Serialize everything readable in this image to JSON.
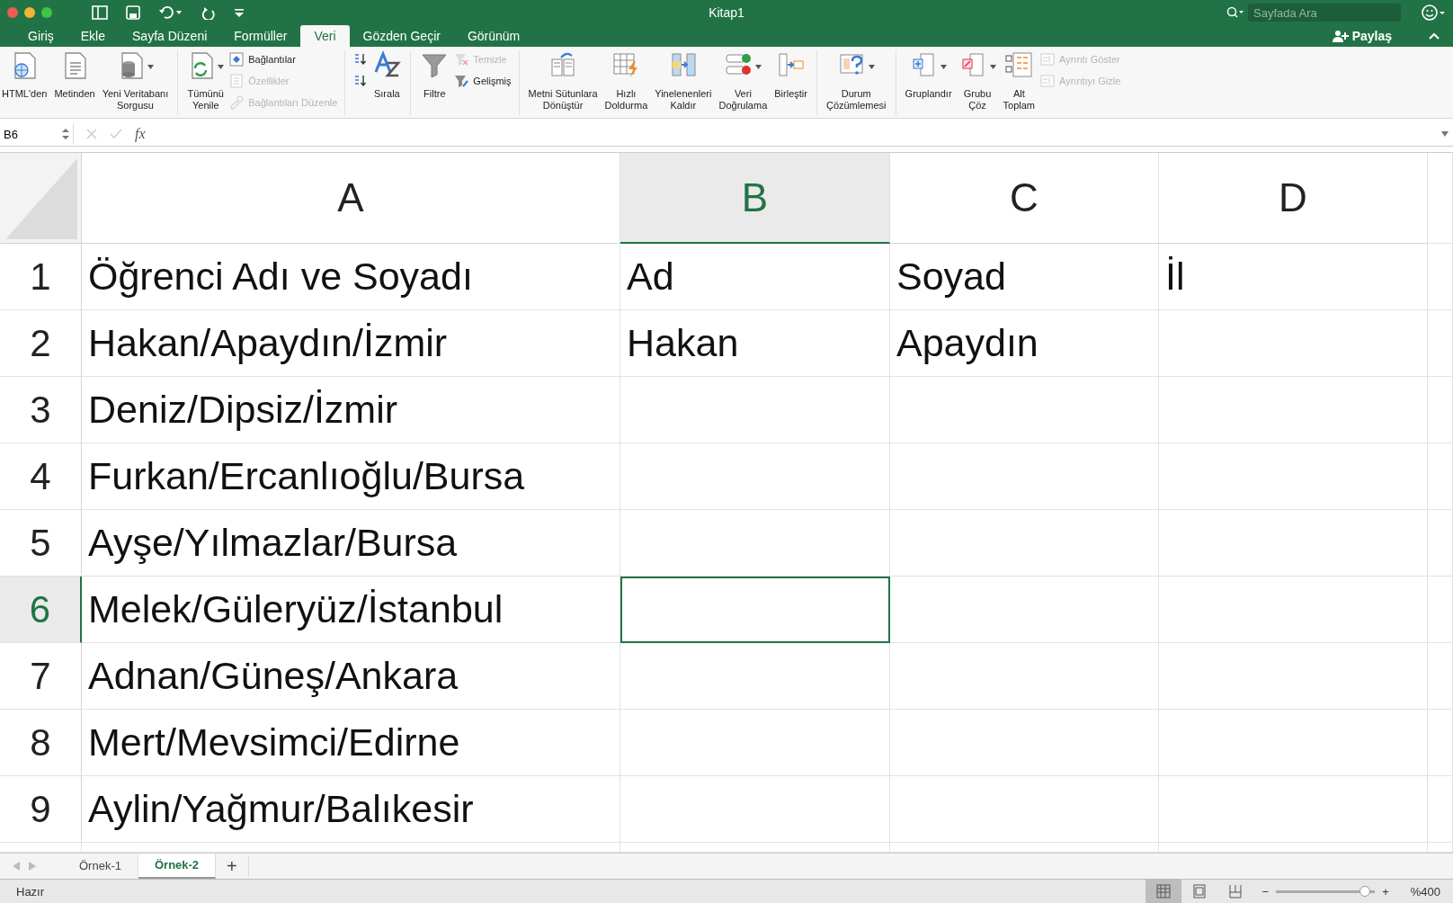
{
  "window": {
    "title": "Kitap1",
    "search": {
      "placeholder": "Sayfada Ara"
    }
  },
  "tabs": [
    {
      "label": "Giriş",
      "selected": false
    },
    {
      "label": "Ekle",
      "selected": false
    },
    {
      "label": "Sayfa Düzeni",
      "selected": false
    },
    {
      "label": "Formüller",
      "selected": false
    },
    {
      "label": "Veri",
      "selected": true
    },
    {
      "label": "Gözden Geçir",
      "selected": false
    },
    {
      "label": "Görünüm",
      "selected": false
    }
  ],
  "share": {
    "label": "Paylaş"
  },
  "ribbon": [
    {
      "items": [
        {
          "kind": "large",
          "lines": [
            "HTML'den"
          ],
          "disabled": false,
          "dropdown": false
        },
        {
          "kind": "large",
          "lines": [
            "Metinden"
          ],
          "disabled": false,
          "dropdown": false
        },
        {
          "kind": "large",
          "lines": [
            "Yeni Veritabanı",
            "Sorgusu"
          ],
          "disabled": false,
          "dropdown": true
        }
      ]
    },
    {
      "items": [
        {
          "kind": "large",
          "lines": [
            "Tümünü",
            "Yenile"
          ],
          "disabled": false,
          "dropdown": true
        },
        {
          "kind": "small",
          "lines": [
            "Bağlantılar"
          ],
          "disabled": false
        },
        {
          "kind": "small",
          "lines": [
            "Özellikler"
          ],
          "disabled": true
        },
        {
          "kind": "small",
          "lines": [
            "Bağlantıları Düzenle"
          ],
          "disabled": true
        }
      ]
    },
    {
      "items": [
        {
          "kind": "icon"
        },
        {
          "kind": "icon"
        },
        {
          "kind": "large",
          "lines": [
            "Sırala"
          ],
          "disabled": false,
          "dropdown": false
        }
      ]
    },
    {
      "items": [
        {
          "kind": "large",
          "lines": [
            "Filtre"
          ],
          "disabled": false,
          "dropdown": false
        },
        {
          "kind": "small",
          "lines": [
            "Temizle"
          ],
          "disabled": true
        },
        {
          "kind": "small",
          "lines": [
            "Gelişmiş"
          ],
          "disabled": false
        }
      ]
    },
    {
      "items": [
        {
          "kind": "large",
          "lines": [
            "Metni Sütunlara",
            "Dönüştür"
          ],
          "disabled": false,
          "dropdown": false
        },
        {
          "kind": "large",
          "lines": [
            "Hızlı",
            "Doldurma"
          ],
          "disabled": false,
          "dropdown": false
        },
        {
          "kind": "large",
          "lines": [
            "Yinelenenleri",
            "Kaldır"
          ],
          "disabled": false,
          "dropdown": false
        },
        {
          "kind": "large",
          "lines": [
            "Veri",
            "Doğrulama"
          ],
          "disabled": false,
          "dropdown": true
        },
        {
          "kind": "large",
          "lines": [
            "Birleştir"
          ],
          "disabled": false,
          "dropdown": false
        }
      ]
    },
    {
      "items": [
        {
          "kind": "large",
          "lines": [
            "Durum",
            "Çözümlemesi"
          ],
          "disabled": false,
          "dropdown": true
        }
      ]
    },
    {
      "items": [
        {
          "kind": "large",
          "lines": [
            "Gruplandır"
          ],
          "disabled": false,
          "dropdown": true
        },
        {
          "kind": "large",
          "lines": [
            "Grubu",
            "Çöz"
          ],
          "disabled": false,
          "dropdown": true
        },
        {
          "kind": "large",
          "lines": [
            "Alt",
            "Toplam"
          ],
          "disabled": false,
          "dropdown": false
        },
        {
          "kind": "small",
          "lines": [
            "Ayrıntı Göster"
          ],
          "disabled": true
        },
        {
          "kind": "small",
          "lines": [
            "Ayrıntıyı Gizle"
          ],
          "disabled": true
        }
      ]
    }
  ],
  "formula_bar": {
    "name_box": "B6",
    "fx": "fx"
  },
  "columns": [
    {
      "label": "A",
      "selected": false
    },
    {
      "label": "B",
      "selected": true
    },
    {
      "label": "C",
      "selected": false
    },
    {
      "label": "D",
      "selected": false
    }
  ],
  "rows": [
    {
      "number": "1",
      "selected": false,
      "cells": [
        {
          "text": "Öğrenci Adı ve Soyadı",
          "selected": false
        },
        {
          "text": "Ad",
          "selected": false
        },
        {
          "text": "Soyad",
          "selected": false
        },
        {
          "text": "İl",
          "selected": false
        }
      ]
    },
    {
      "number": "2",
      "selected": false,
      "cells": [
        {
          "text": "Hakan/Apaydın/İzmir",
          "selected": false
        },
        {
          "text": "Hakan",
          "selected": false
        },
        {
          "text": "Apaydın",
          "selected": false
        },
        {
          "selected": false
        }
      ]
    },
    {
      "number": "3",
      "selected": false,
      "cells": [
        {
          "text": "Deniz/Dipsiz/İzmir",
          "selected": false
        },
        {
          "selected": false
        },
        {
          "selected": false
        },
        {
          "selected": false
        }
      ]
    },
    {
      "number": "4",
      "selected": false,
      "cells": [
        {
          "text": "Furkan/Ercanlıoğlu/Bursa",
          "selected": false
        },
        {
          "selected": false
        },
        {
          "selected": false
        },
        {
          "selected": false
        }
      ]
    },
    {
      "number": "5",
      "selected": false,
      "cells": [
        {
          "text": "Ayşe/Yılmazlar/Bursa",
          "selected": false
        },
        {
          "selected": false
        },
        {
          "selected": false
        },
        {
          "selected": false
        }
      ]
    },
    {
      "number": "6",
      "selected": true,
      "cells": [
        {
          "text": "Melek/Güleryüz/İstanbul",
          "selected": false
        },
        {
          "selected": true
        },
        {
          "selected": false
        },
        {
          "selected": false
        }
      ]
    },
    {
      "number": "7",
      "selected": false,
      "cells": [
        {
          "text": "Adnan/Güneş/Ankara",
          "selected": false
        },
        {
          "selected": false
        },
        {
          "selected": false
        },
        {
          "selected": false
        }
      ]
    },
    {
      "number": "8",
      "selected": false,
      "cells": [
        {
          "text": "Mert/Mevsimci/Edirne",
          "selected": false
        },
        {
          "selected": false
        },
        {
          "selected": false
        },
        {
          "selected": false
        }
      ]
    },
    {
      "number": "9",
      "selected": false,
      "cells": [
        {
          "text": "Aylin/Yağmur/Balıkesir",
          "selected": false
        },
        {
          "selected": false
        },
        {
          "selected": false
        },
        {
          "selected": false
        }
      ]
    }
  ],
  "sheets": [
    {
      "label": "Örnek-1",
      "selected": false
    },
    {
      "label": "Örnek-2",
      "selected": true
    }
  ],
  "add_sheet": "+",
  "status_bar": {
    "text": "Hazır",
    "views": [
      {
        "selected": true
      },
      {
        "selected": false
      },
      {
        "selected": false
      }
    ],
    "zoom": {
      "level": 0.95,
      "minus": "−",
      "plus": "+",
      "reading": "%400"
    }
  }
}
